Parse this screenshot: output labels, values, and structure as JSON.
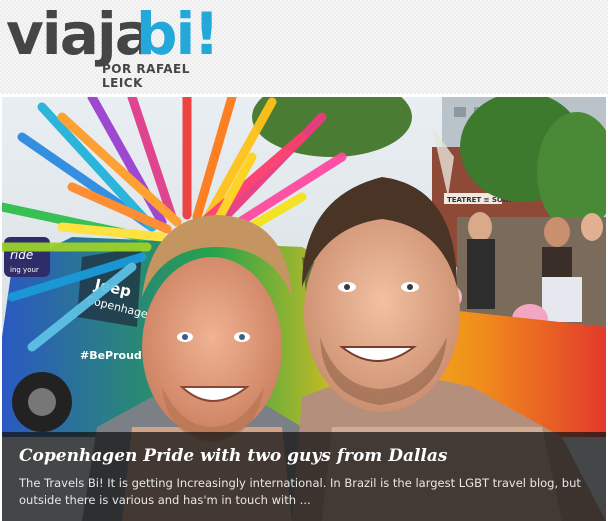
{
  "header": {
    "logo_main": "viaja",
    "logo_accent": "bi!",
    "logo_tagline": "POR RAFAEL LEICK"
  },
  "colors": {
    "logo_gray": "#454545",
    "logo_blue": "#23a8d9"
  },
  "post": {
    "title": "Copenhagen Pride with two guys from Dallas",
    "excerpt": "The Travels Bi! It is getting Increasingly international. In Brazil is the largest LGBT travel blog, but outside there is various and has'm in touch with ...",
    "image_text": {
      "car_brand": "Jeep",
      "car_city": "Copenhagen",
      "car_hashtag": "#BeProud",
      "car_pride": "ride",
      "car_small": "ing your",
      "shop_sign": "TEATRET ≡ SORT"
    }
  }
}
